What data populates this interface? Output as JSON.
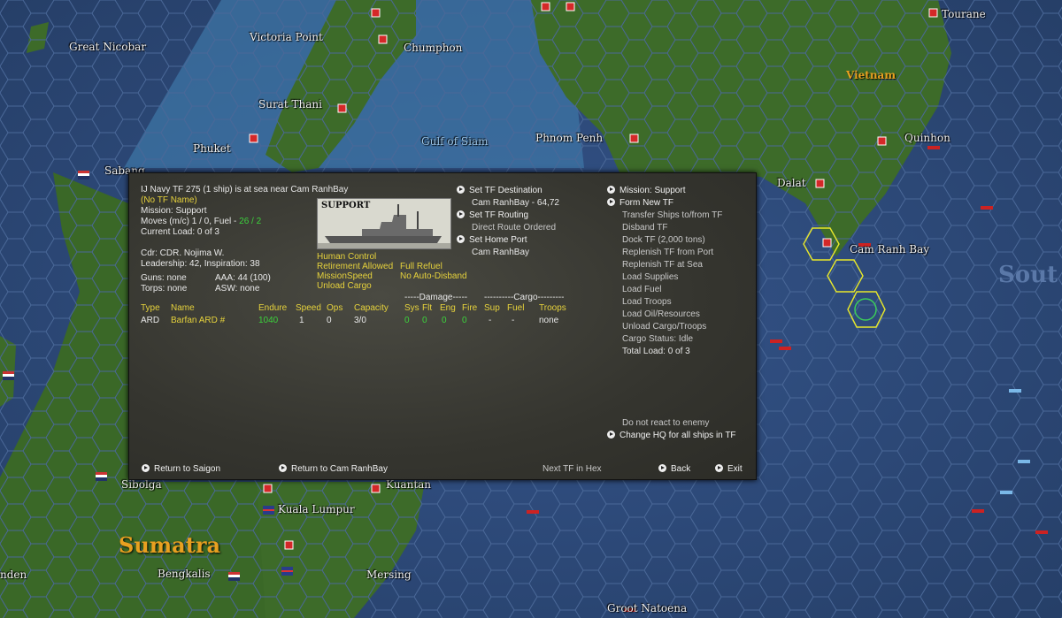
{
  "map": {
    "places": [
      {
        "id": "great-nicobar",
        "label": "Great Nicobar"
      },
      {
        "id": "victoria-point",
        "label": "Victoria Point"
      },
      {
        "id": "chumphon",
        "label": "Chumphon"
      },
      {
        "id": "tourane",
        "label": "Tourane"
      },
      {
        "id": "surat-thani",
        "label": "Surat Thani"
      },
      {
        "id": "gulf-of-siam",
        "label": "Gulf of Siam"
      },
      {
        "id": "phuket",
        "label": "Phuket"
      },
      {
        "id": "phnom-penh",
        "label": "Phnom Penh"
      },
      {
        "id": "quinhon",
        "label": "Quinhon"
      },
      {
        "id": "sabang",
        "label": "Sabang"
      },
      {
        "id": "dalat",
        "label": "Dalat"
      },
      {
        "id": "cam-ranh-bay",
        "label": "Cam Ranh Bay"
      },
      {
        "id": "sibolga",
        "label": "Sibolga"
      },
      {
        "id": "kuantan",
        "label": "Kuantan"
      },
      {
        "id": "kuala-lumpur",
        "label": "Kuala Lumpur"
      },
      {
        "id": "bengkalis",
        "label": "Bengkalis"
      },
      {
        "id": "mersing",
        "label": "Mersing"
      },
      {
        "id": "groot-natoena",
        "label": "Groot Natoena"
      },
      {
        "id": "nden",
        "label": "nden"
      }
    ],
    "regions": {
      "vietnam": "Vietnam",
      "sumatra": "Sumatra",
      "south": "Sout"
    }
  },
  "panel": {
    "header": {
      "title": "IJ Navy TF 275 (1 ship) is at sea near Cam RanhBay",
      "tf_name": "(No TF Name)",
      "mission": "Mission: Support",
      "moves_label": "Moves (m/c) 1 / 0, Fuel - ",
      "moves_fuel": "26 / 2",
      "current_load": "Current Load: 0 of 3"
    },
    "commander": {
      "cdr": "Cdr: CDR. Nojima W.",
      "leadership": "Leadership: 42, Inspiration: 38",
      "guns": "Guns: none",
      "aaa": "AAA: 44 (100)",
      "torps": "Torps: none",
      "asw": "ASW: none"
    },
    "ship_image_label": "SUPPORT",
    "orders": {
      "human_control": "Human Control",
      "retirement": "Retirement Allowed",
      "full_refuel": "Full Refuel",
      "mission_speed": "MissionSpeed",
      "no_auto_disband": "No Auto-Disband",
      "unload_cargo": "Unload Cargo"
    },
    "destination": {
      "set_dest": "Set TF Destination",
      "dest_value": "Cam RanhBay - 64,72",
      "set_routing": "Set TF Routing",
      "routing_value": "Direct Route Ordered",
      "set_home": "Set Home Port",
      "home_value": "Cam RanhBay"
    },
    "table": {
      "damage_header": "-----Damage-----",
      "cargo_header": "----------Cargo---------",
      "columns": [
        "Type",
        "Name",
        "Endure",
        "Speed",
        "Ops",
        "Capacity",
        "Sys",
        "Flt",
        "Eng",
        "Fire",
        "Sup",
        "Fuel",
        "Troops"
      ],
      "rows": [
        {
          "type": "ARD",
          "name": "Barfan ARD #",
          "endure": "1040",
          "speed": "1",
          "ops": "0",
          "capacity": "3/0",
          "sys": "0",
          "flt": "0",
          "eng": "0",
          "fire": "0",
          "sup": "-",
          "fuel": "-",
          "troops": "none"
        }
      ]
    },
    "right_menu": {
      "mission": "Mission: Support",
      "form_new": "Form New TF",
      "items": [
        "Transfer Ships to/from TF",
        "Disband TF",
        "Dock TF (2,000 tons)",
        "Replenish TF from Port",
        "Replenish TF at Sea",
        "Load Supplies",
        "Load Fuel",
        "Load Troops",
        "Load Oil/Resources",
        "Unload Cargo/Troops",
        "Cargo Status: Idle",
        "Total Load: 0 of 3"
      ],
      "no_react": "Do not react to enemy",
      "change_hq": "Change HQ for all ships in TF"
    },
    "footer": {
      "return_saigon": "Return to Saigon",
      "return_cam": "Return to Cam RanhBay",
      "next_tf": "Next TF in Hex",
      "back": "Back",
      "exit": "Exit"
    }
  },
  "colors": {
    "ocean": "#2e4a78",
    "land": "#3c6a2a",
    "panel": "#3a3a34",
    "yellow": "#e6d23c",
    "green": "#3cd23c"
  }
}
